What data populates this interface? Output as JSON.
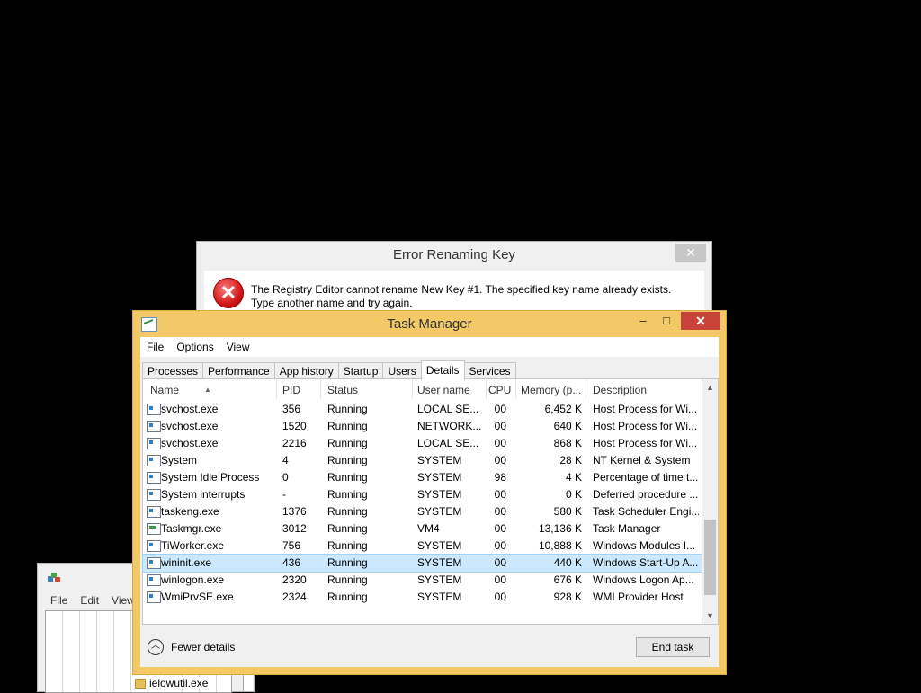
{
  "regedit": {
    "menu": [
      "File",
      "Edit",
      "View"
    ],
    "tree_item": "ielowutil.exe"
  },
  "error_dialog": {
    "title": "Error Renaming Key",
    "close": "✕",
    "message": "The Registry Editor cannot rename New Key #1. The specified key name already exists. Type another name and try again.",
    "icon": "error-icon"
  },
  "task_manager": {
    "title": "Task Manager",
    "controls": {
      "minimize": "–",
      "maximize": "□",
      "close": "✕"
    },
    "menu": [
      "File",
      "Options",
      "View"
    ],
    "tabs": [
      "Processes",
      "Performance",
      "App history",
      "Startup",
      "Users",
      "Details",
      "Services"
    ],
    "active_tab": "Details",
    "columns": {
      "name": "Name",
      "pid": "PID",
      "status": "Status",
      "user": "User name",
      "cpu": "CPU",
      "memory": "Memory (p...",
      "description": "Description"
    },
    "rows": [
      {
        "name": "svchost.exe",
        "pid": "356",
        "status": "Running",
        "user": "LOCAL SE...",
        "cpu": "00",
        "memory": "6,452 K",
        "description": "Host Process for Wi..."
      },
      {
        "name": "svchost.exe",
        "pid": "1520",
        "status": "Running",
        "user": "NETWORK...",
        "cpu": "00",
        "memory": "640 K",
        "description": "Host Process for Wi..."
      },
      {
        "name": "svchost.exe",
        "pid": "2216",
        "status": "Running",
        "user": "LOCAL SE...",
        "cpu": "00",
        "memory": "868 K",
        "description": "Host Process for Wi..."
      },
      {
        "name": "System",
        "pid": "4",
        "status": "Running",
        "user": "SYSTEM",
        "cpu": "00",
        "memory": "28 K",
        "description": "NT Kernel & System"
      },
      {
        "name": "System Idle Process",
        "pid": "0",
        "status": "Running",
        "user": "SYSTEM",
        "cpu": "98",
        "memory": "4 K",
        "description": "Percentage of time t..."
      },
      {
        "name": "System interrupts",
        "pid": "-",
        "status": "Running",
        "user": "SYSTEM",
        "cpu": "00",
        "memory": "0 K",
        "description": "Deferred procedure ..."
      },
      {
        "name": "taskeng.exe",
        "pid": "1376",
        "status": "Running",
        "user": "SYSTEM",
        "cpu": "00",
        "memory": "580 K",
        "description": "Task Scheduler Engi..."
      },
      {
        "name": "Taskmgr.exe",
        "pid": "3012",
        "status": "Running",
        "user": "VM4",
        "cpu": "00",
        "memory": "13,136 K",
        "description": "Task Manager"
      },
      {
        "name": "TiWorker.exe",
        "pid": "756",
        "status": "Running",
        "user": "SYSTEM",
        "cpu": "00",
        "memory": "10,888 K",
        "description": "Windows Modules I..."
      },
      {
        "name": "wininit.exe",
        "pid": "436",
        "status": "Running",
        "user": "SYSTEM",
        "cpu": "00",
        "memory": "440 K",
        "description": "Windows Start-Up A..."
      },
      {
        "name": "winlogon.exe",
        "pid": "2320",
        "status": "Running",
        "user": "SYSTEM",
        "cpu": "00",
        "memory": "676 K",
        "description": "Windows Logon Ap..."
      },
      {
        "name": "WmiPrvSE.exe",
        "pid": "2324",
        "status": "Running",
        "user": "SYSTEM",
        "cpu": "00",
        "memory": "928 K",
        "description": "WMI Provider Host"
      }
    ],
    "selected_row": "wininit.exe",
    "fewer_details": "Fewer details",
    "end_task": "End task",
    "colors": {
      "frame": "#f3c968",
      "close": "#c8433a",
      "selection": "#cce8ff"
    }
  }
}
